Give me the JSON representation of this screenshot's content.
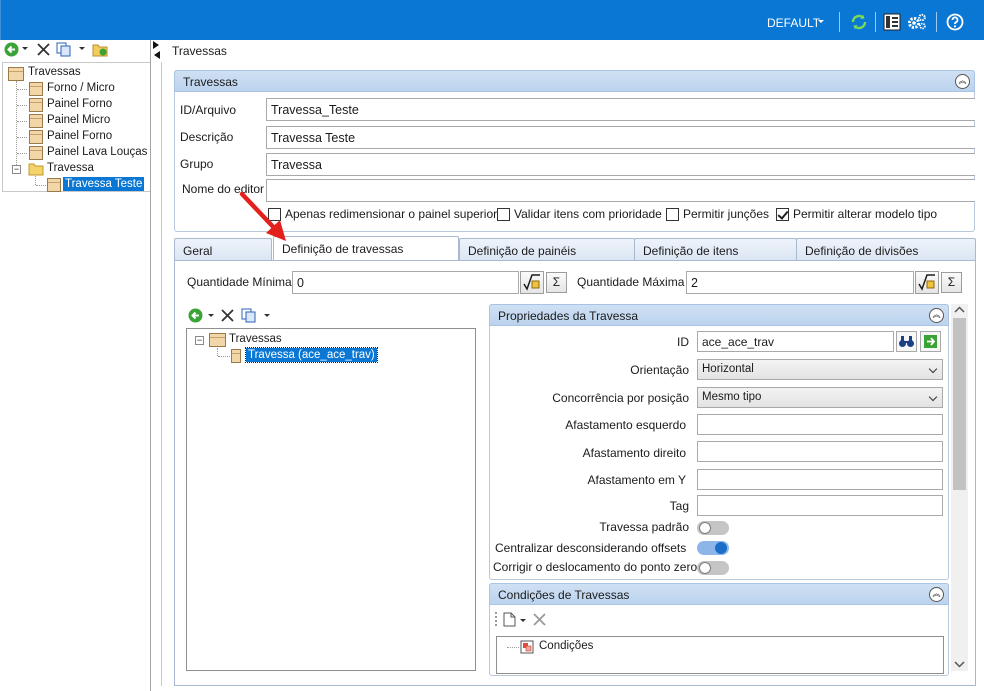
{
  "titlebar": {
    "profile_label": "DEFAULT",
    "icons": [
      "refresh-icon",
      "panel-layout-icon",
      "settings-gears-icon",
      "help-icon"
    ]
  },
  "left_tree": {
    "root": "Travessas",
    "items": [
      "Forno / Micro",
      "Painel Forno",
      "Painel Micro",
      "Painel Forno",
      "Painel Lava Louças"
    ],
    "folder": "Travessa",
    "selected_child": "Travessa Teste"
  },
  "breadcrumb": "Travessas",
  "travessas_section": {
    "title": "Travessas",
    "fields": {
      "id_label": "ID/Arquivo",
      "id_value": "Travessa_Teste",
      "desc_label": "Descrição",
      "desc_value": "Travessa Teste",
      "group_label": "Grupo",
      "group_value": "Travessa",
      "editor_label": "Nome do editor",
      "editor_value": ""
    },
    "checkboxes": [
      {
        "label": "Apenas redimensionar o painel superior",
        "checked": false
      },
      {
        "label": "Validar itens com prioridade",
        "checked": false
      },
      {
        "label": "Permitir junções",
        "checked": false
      },
      {
        "label": "Permitir alterar modelo tipo",
        "checked": true
      }
    ]
  },
  "tabs": [
    "Geral",
    "Definição de travessas",
    "Definição de painéis",
    "Definição de itens",
    "Definição de divisões"
  ],
  "active_tab": "Definição de travessas",
  "quantities": {
    "min_label": "Quantidade Mínima",
    "min_value": "0",
    "max_label": "Quantidade Máxima",
    "max_value": "2",
    "sigma": "Σ"
  },
  "inner_tree": {
    "root": "Travessas",
    "selected_child": "Travessa (ace_ace_trav)"
  },
  "properties": {
    "title": "Propriedades da Travessa",
    "id_label": "ID",
    "id_value": "ace_ace_trav",
    "orientation_label": "Orientação",
    "orientation_value": "Horizontal",
    "concurrency_label": "Concorrência por posição",
    "concurrency_value": "Mesmo tipo",
    "left_offset_label": "Afastamento esquerdo",
    "right_offset_label": "Afastamento direito",
    "y_offset_label": "Afastamento em Y",
    "tag_label": "Tag",
    "default_label": "Travessa padrão",
    "default_on": false,
    "center_label": "Centralizar desconsiderando offsets",
    "center_on": true,
    "fix_label": "Corrigir o deslocamento do ponto zero",
    "fix_on": false
  },
  "conditions": {
    "title": "Condições de Travessas",
    "node": "Condições"
  },
  "colors": {
    "titlebar": "#0a77d4",
    "selection": "#0a77d4",
    "section_header": "#c7dbf1",
    "annotation_arrow": "#e3201b"
  }
}
